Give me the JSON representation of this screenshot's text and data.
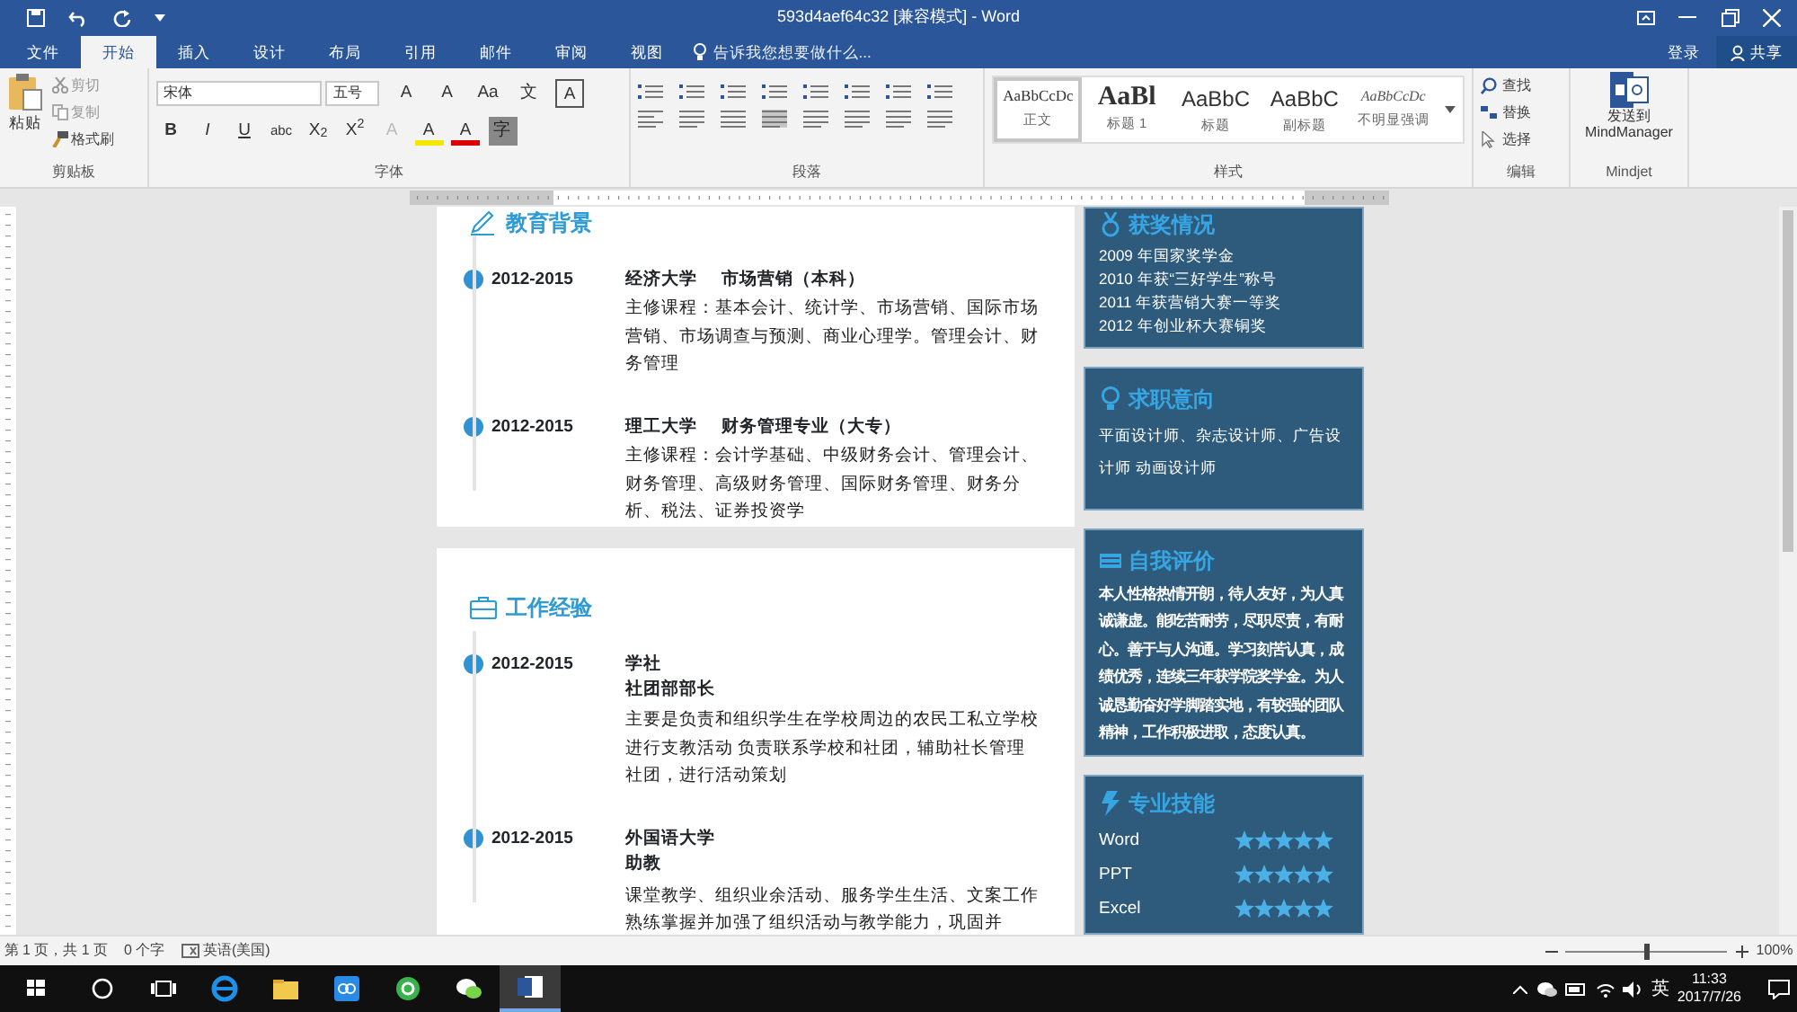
{
  "window": {
    "title": "593d4aef64c32 [兼容模式] - Word"
  },
  "tabs": [
    {
      "label": "文件",
      "selected": false
    },
    {
      "label": "开始",
      "selected": true
    },
    {
      "label": "插入",
      "selected": false
    },
    {
      "label": "设计",
      "selected": false
    },
    {
      "label": "布局",
      "selected": false
    },
    {
      "label": "引用",
      "selected": false
    },
    {
      "label": "邮件",
      "selected": false
    },
    {
      "label": "审阅",
      "selected": false
    },
    {
      "label": "视图",
      "selected": false
    }
  ],
  "tell_me": {
    "placeholder": "告诉我您想要做什么..."
  },
  "account": {
    "sign_in": "登录",
    "share": "共享"
  },
  "ribbon": {
    "clipboard": {
      "label": "剪贴板",
      "paste": "粘贴",
      "cut": "剪切",
      "copy": "复制",
      "format_painter": "格式刷"
    },
    "font": {
      "label": "字体",
      "font_name": "宋体",
      "font_size": "五号",
      "row1": [
        "A",
        "A",
        "Aa",
        "文",
        "A"
      ],
      "row2": [
        "B",
        "I",
        "U",
        "abc",
        "X$_{2}$",
        "X$^{2}$",
        "A",
        "A",
        "A",
        "字"
      ]
    },
    "paragraph": {
      "label": "段落"
    },
    "styles": {
      "label": "样式",
      "items": [
        {
          "preview": "AaBbCcDc",
          "name": "正文",
          "selected": true
        },
        {
          "preview": "AaBl",
          "name": "标题 1",
          "selected": false
        },
        {
          "preview": "AaBbC",
          "name": "标题",
          "selected": false
        },
        {
          "preview": "AaBbC",
          "name": "副标题",
          "selected": false
        },
        {
          "preview": "AaBbCcDc",
          "name": "不明显强调",
          "selected": false
        }
      ]
    },
    "editing": {
      "label": "编辑",
      "find": "查找",
      "replace": "替换",
      "select": "选择"
    },
    "mindjet": {
      "label": "Mindjet",
      "button": "发送到 MindManager"
    }
  },
  "education": {
    "title": "教育背景",
    "entries": [
      {
        "date": "2012-2015",
        "school": "经济大学",
        "major": "市场营销（本科）",
        "description": "主修课程：基本会计、统计学、市场营销、国际市场营销、市场调查与预测、商业心理学。管理会计、财务管理"
      },
      {
        "date": "2012-2015",
        "school": "理工大学",
        "major": "财务管理专业（大专）",
        "description": "主修课程：会计学基础、中级财务会计、管理会计、财务管理、高级财务管理、国际财务管理、财务分析、税法、证券投资学"
      }
    ]
  },
  "work": {
    "title": "工作经验",
    "entries": [
      {
        "date": "2012-2015",
        "org": "学社",
        "role": "社团部部长",
        "description": "主要是负责和组织学生在学校周边的农民工私立学校进行支教活动 负责联系学校和社团，辅助社长管理社团，进行活动策划"
      },
      {
        "date": "2012-2015",
        "org": "外国语大学",
        "role": "助教",
        "description": "课堂教学、组织业余活动、服务学生生活、文案工作熟练掌握并加强了组织活动与教学能力，巩固并"
      }
    ]
  },
  "awards": {
    "title": "获奖情况",
    "items": [
      "2009 年国家奖学金",
      "2010 年获“三好学生”称号",
      "2011 年获营销大赛一等奖",
      "2012 年创业杯大赛铜奖"
    ]
  },
  "job_intention": {
    "title": "求职意向",
    "text": "平面设计师、杂志设计师、广告设计师 动画设计师"
  },
  "self_evaluation": {
    "title": "自我评价",
    "text": "本人性格热情开朗，待人友好，为人真诚谦虚。能吃苦耐劳，尽职尽责，有耐心。善于与人沟通。学习刻苦认真，成绩优秀，连续三年获学院奖学金。为人诚恳勤奋好学脚踏实地，有较强的团队精神，工作积极进取，态度认真。"
  },
  "skills": {
    "title": "专业技能",
    "items": [
      {
        "name": "Word",
        "stars": 5
      },
      {
        "name": "PPT",
        "stars": 5
      },
      {
        "name": "Excel",
        "stars": 5
      }
    ]
  },
  "status_bar": {
    "page": "第 1 页，共 1 页",
    "words": "0 个字",
    "language": "英语(美国)",
    "zoom": "100%",
    "zoom_slider": {
      "level": 0.5
    }
  },
  "taskbar": {
    "ime": "英",
    "time": "11:33",
    "date": "2017/7/26"
  }
}
